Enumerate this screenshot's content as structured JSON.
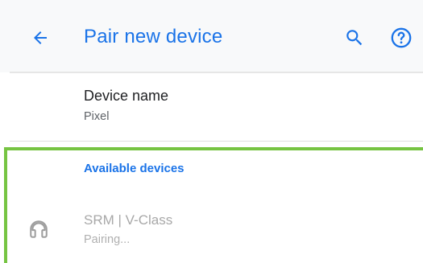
{
  "app_bar": {
    "title": "Pair new device",
    "back_icon": "arrow-back-icon",
    "search_icon": "search-icon",
    "help_icon": "help-icon",
    "accent_color": "#1a73e8"
  },
  "device_name": {
    "title": "Device name",
    "value": "Pixel"
  },
  "available_devices": {
    "header": "Available devices",
    "highlight_color": "#76c442",
    "items": [
      {
        "icon": "headset-icon",
        "name": "SRM | V-Class",
        "status": "Pairing..."
      }
    ]
  }
}
